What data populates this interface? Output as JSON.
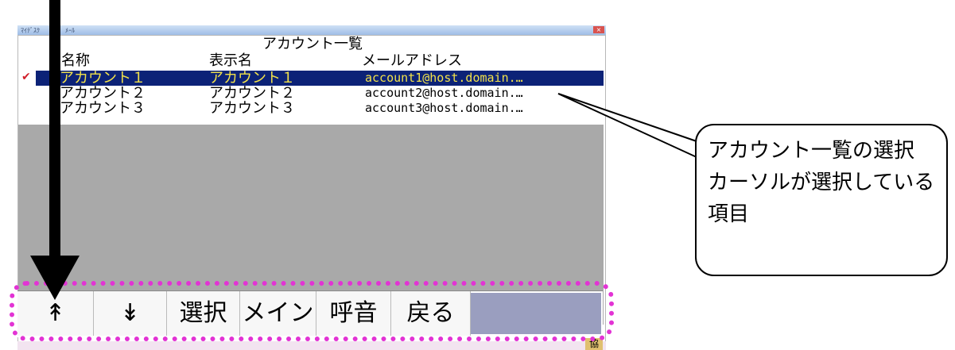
{
  "window": {
    "titlebar_left": "ﾏｲﾃﾞｽｸ",
    "titlebar_left2": "ﾒｰﾙ",
    "close_label": "×"
  },
  "list": {
    "title": "アカウント一覧",
    "columns": [
      "名称",
      "表示名",
      "メールアドレス"
    ],
    "rows": [
      {
        "name": "アカウント１",
        "display": "アカウント１",
        "mail": "account1@host.domain.…",
        "selected": true
      },
      {
        "name": "アカウント２",
        "display": "アカウント２",
        "mail": "account2@host.domain.…",
        "selected": false
      },
      {
        "name": "アカウント３",
        "display": "アカウント３",
        "mail": "account3@host.domain.…",
        "selected": false
      }
    ],
    "check_glyph": "✔"
  },
  "toolbar": {
    "up_label": "↟",
    "down_label": "↡",
    "select_label": "選択",
    "main_label": "メイン",
    "ring_label": "呼音",
    "back_label": "戻る"
  },
  "callout": {
    "line1": "アカウント一覧の選択",
    "line2": "カーソルが選択している",
    "line3": "項目"
  },
  "corner": {
    "icon_text": "協"
  },
  "colors": {
    "selection_bg": "#0c2277",
    "selection_text": "#f2e24a",
    "highlight": "#e233d4",
    "list_empty": "#a9a9a9"
  }
}
